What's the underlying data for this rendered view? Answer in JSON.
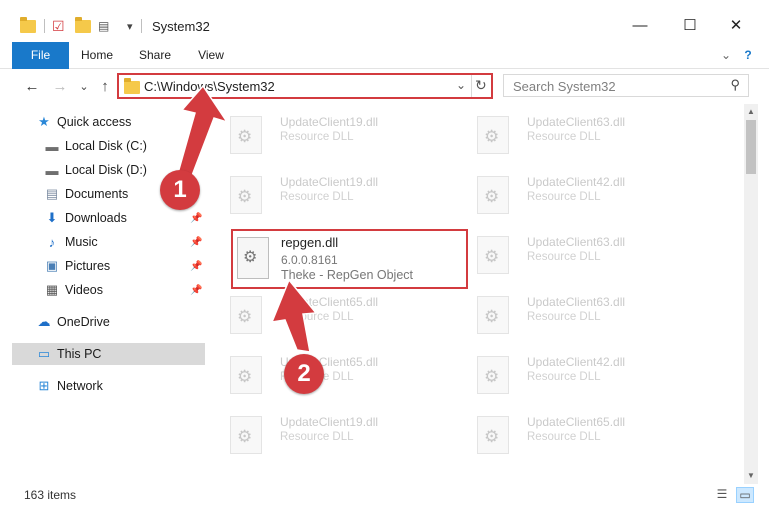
{
  "window": {
    "title": "System32",
    "minimize": "—",
    "maximize": "☐",
    "close": "✕",
    "qa_dropdown": "▾"
  },
  "ribbon": {
    "tabs": [
      {
        "label": "File"
      },
      {
        "label": "Home"
      },
      {
        "label": "Share"
      },
      {
        "label": "View"
      }
    ],
    "expand_icon": "⌄",
    "help_icon": "?"
  },
  "navigation": {
    "back": "←",
    "forward": "→",
    "recent": "⌄",
    "up": "↑"
  },
  "address": {
    "path": "C:\\Windows\\System32",
    "dropdown": "⌄",
    "refresh": "↻"
  },
  "search": {
    "placeholder": "Search System32",
    "icon": "⚲"
  },
  "sidebar": {
    "items": [
      {
        "label": "Quick access",
        "icon": "star-icon",
        "glyph": "★",
        "color": "#2b88d8"
      },
      {
        "label": "Local Disk (C:)",
        "icon": "drive-icon",
        "glyph": "▬",
        "color": "#6f6f6f"
      },
      {
        "label": "Local Disk (D:)",
        "icon": "drive-icon",
        "glyph": "▬",
        "color": "#6f6f6f"
      },
      {
        "label": "Documents",
        "icon": "documents-icon",
        "glyph": "▤",
        "color": "#7a8aa0"
      },
      {
        "label": "Downloads",
        "icon": "download-icon",
        "glyph": "⬇",
        "color": "#1e6fc8"
      },
      {
        "label": "Music",
        "icon": "music-icon",
        "glyph": "♪",
        "color": "#1e6fc8"
      },
      {
        "label": "Pictures",
        "icon": "pictures-icon",
        "glyph": "▣",
        "color": "#4a7fb5"
      },
      {
        "label": "Videos",
        "icon": "videos-icon",
        "glyph": "▦",
        "color": "#555555"
      },
      {
        "label": "OneDrive",
        "icon": "cloud-icon",
        "glyph": "☁",
        "color": "#1e6fc8"
      },
      {
        "label": "This PC",
        "icon": "computer-icon",
        "glyph": "▭",
        "color": "#2b88d8"
      },
      {
        "label": "Network",
        "icon": "network-icon",
        "glyph": "⊞",
        "color": "#2b88d8"
      }
    ],
    "pin_glyph": "📌"
  },
  "files": [
    {
      "name": "UpdateClient19.dll",
      "desc": "Resource DLL"
    },
    {
      "name": "UpdateClient63.dll",
      "desc": "Resource DLL"
    },
    {
      "name": "UpdateClient19.dll",
      "desc": "Resource DLL"
    },
    {
      "name": "UpdateClient42.dll",
      "desc": "Resource DLL"
    },
    {
      "name": "UpdateClient63.dll",
      "desc": "Resource DLL"
    },
    {
      "name": "UpdateClient65.dll",
      "desc": "Resource DLL"
    },
    {
      "name": "UpdateClient63.dll",
      "desc": "Resource DLL"
    },
    {
      "name": "UpdateClient65.dll",
      "desc": "Resource DLL"
    },
    {
      "name": "UpdateClient42.dll",
      "desc": "Resource DLL"
    },
    {
      "name": "UpdateClient19.dll",
      "desc": "Resource DLL"
    },
    {
      "name": "UpdateClient65.dll",
      "desc": "Resource DLL"
    }
  ],
  "highlighted_file": {
    "name": "repgen.dll",
    "version": "6.0.0.8161",
    "description": "Theke - RepGen Object"
  },
  "status": {
    "item_count": "163 items"
  },
  "annotations": {
    "step1": "1",
    "step2": "2",
    "color": "#d33b3f"
  }
}
